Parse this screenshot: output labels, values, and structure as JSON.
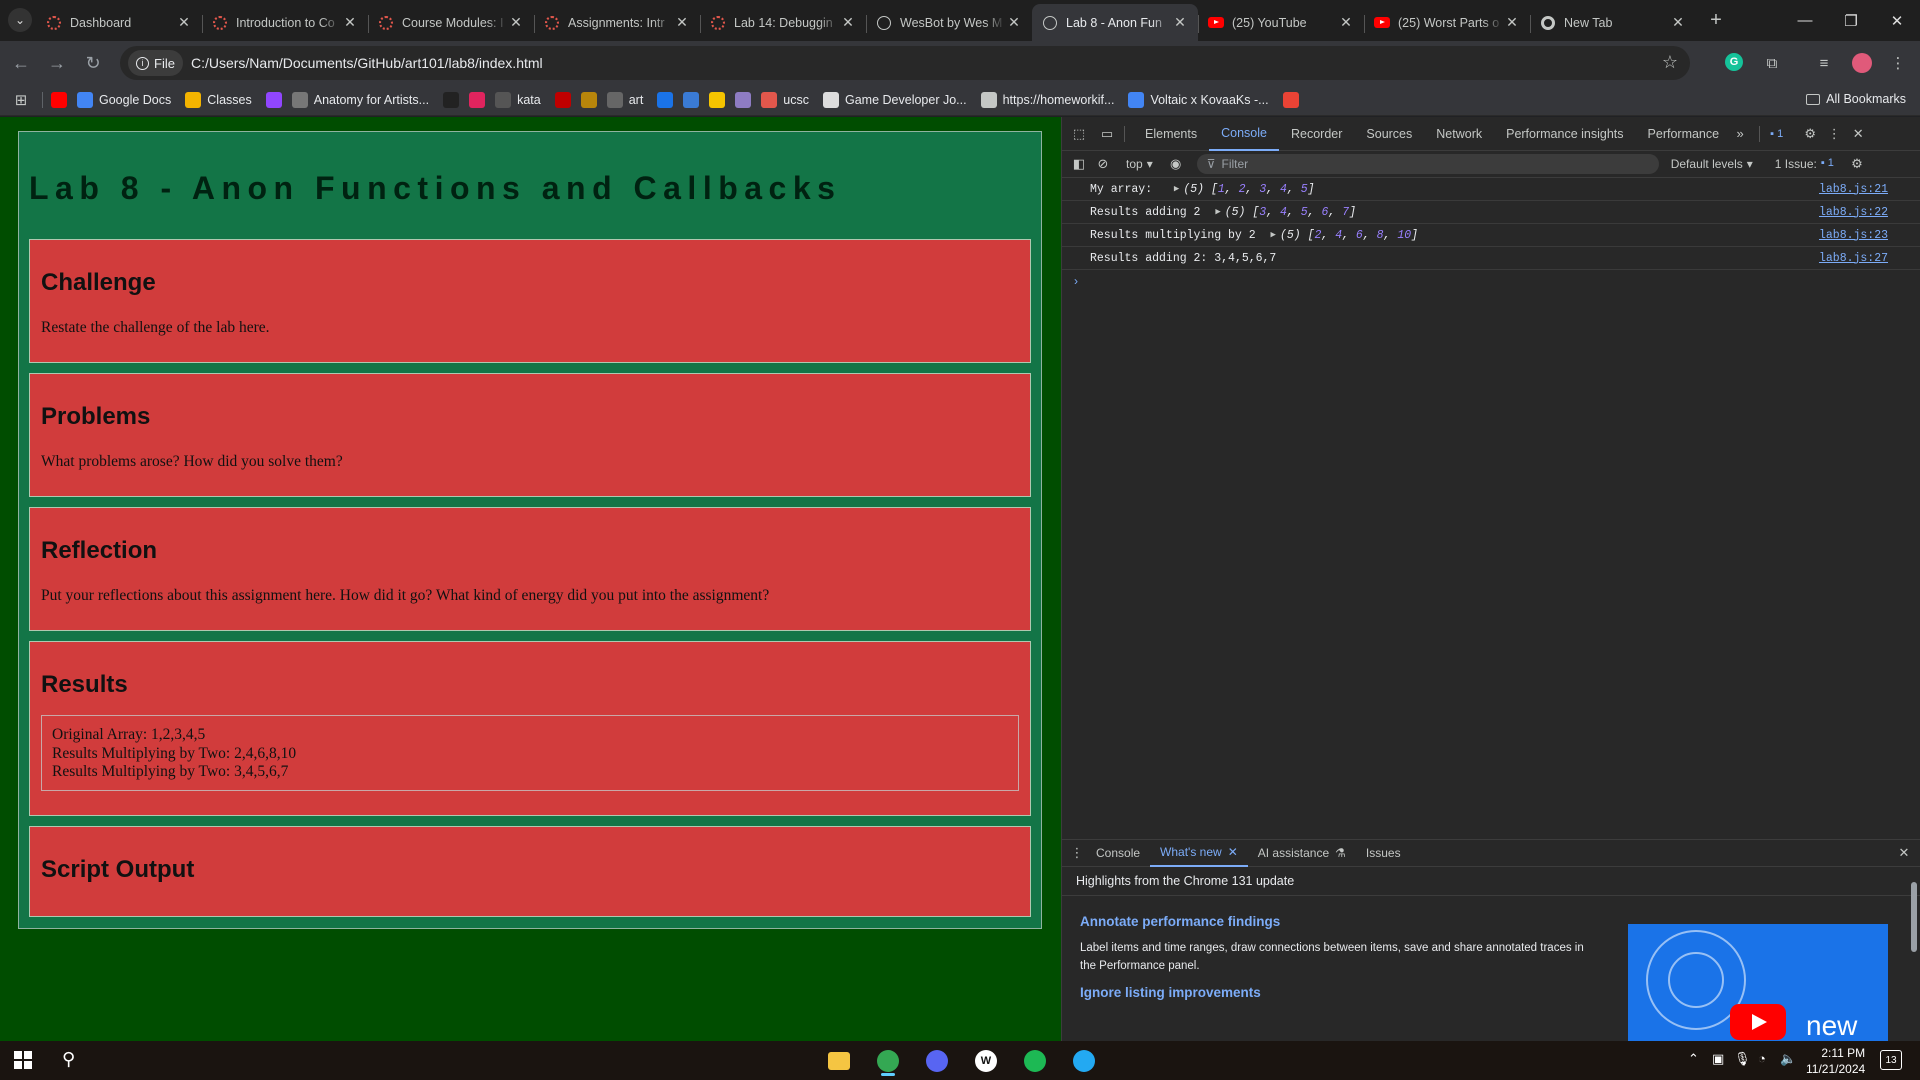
{
  "browser": {
    "tabs": [
      {
        "title": "Dashboard",
        "icon": "canvas-icon"
      },
      {
        "title": "Introduction to Co",
        "icon": "canvas-icon"
      },
      {
        "title": "Course Modules: I",
        "icon": "canvas-icon"
      },
      {
        "title": "Assignments: Intr",
        "icon": "canvas-icon"
      },
      {
        "title": "Lab 14: Debuggin",
        "icon": "canvas-icon"
      },
      {
        "title": "WesBot by Wes M",
        "icon": "web-icon"
      },
      {
        "title": "Lab 8 - Anon Fun",
        "icon": "web-icon",
        "active": true
      },
      {
        "title": "(25) YouTube",
        "icon": "youtube-icon"
      },
      {
        "title": "(25) Worst Parts o",
        "icon": "youtube-icon"
      },
      {
        "title": "New Tab",
        "icon": "chrome-icon"
      }
    ],
    "close_glyph": "✕",
    "new_tab_glyph": "+",
    "window_controls": {
      "minimize": "—",
      "restore": "❐",
      "close": "✕"
    },
    "omnibox": {
      "chip_label": "File",
      "url": "C:/Users/Nam/Documents/GitHub/art101/lab8/index.html"
    },
    "bookmarks": [
      {
        "label": "",
        "icon": "youtube-icon",
        "color": "#ff0000"
      },
      {
        "label": "Google Docs",
        "icon": "docs-icon",
        "color": "#4285f4"
      },
      {
        "label": "Classes",
        "icon": "classes-icon",
        "color": "#f4b400"
      },
      {
        "label": "",
        "icon": "twitch-icon",
        "color": "#9146ff"
      },
      {
        "label": "Anatomy for Artists...",
        "icon": "anatomy-icon",
        "color": "#777777"
      },
      {
        "label": "",
        "icon": "w-icon",
        "color": "#222222"
      },
      {
        "label": "",
        "icon": "red-app-icon",
        "color": "#e0245e"
      },
      {
        "label": "kata",
        "icon": "kata-icon",
        "color": "#555555"
      },
      {
        "label": "",
        "icon": "red-dot-icon",
        "color": "#c00000"
      },
      {
        "label": "",
        "icon": "wand-icon",
        "color": "#b8860b"
      },
      {
        "label": "art",
        "icon": "art-icon",
        "color": "#666666"
      },
      {
        "label": "",
        "icon": "check-icon",
        "color": "#1a73e8"
      },
      {
        "label": "",
        "icon": "bird-icon",
        "color": "#3a7bd5"
      },
      {
        "label": "",
        "icon": "dp-icon",
        "color": "#f5c400"
      },
      {
        "label": "",
        "icon": "image-icon",
        "color": "#8e7cc3"
      },
      {
        "label": "ucsc",
        "icon": "canvas-icon",
        "color": "#e2574c"
      },
      {
        "label": "Game Developer Jo...",
        "icon": "star-icon",
        "color": "#dddddd"
      },
      {
        "label": "https://homeworkif...",
        "icon": "globe-icon",
        "color": "#c4c7c5"
      },
      {
        "label": "Voltaic x KovaaKs -...",
        "icon": "docs-icon",
        "color": "#4285f4"
      },
      {
        "label": "",
        "icon": "gmail-icon",
        "color": "#ea4335"
      }
    ],
    "all_bookmarks": "All Bookmarks"
  },
  "page": {
    "title": "Lab 8 - Anon Functions and Callbacks",
    "sections": [
      {
        "heading": "Challenge",
        "body": "Restate the challenge of the lab here."
      },
      {
        "heading": "Problems",
        "body": "What problems arose? How did you solve them?"
      },
      {
        "heading": "Reflection",
        "body": "Put your reflections about this assignment here. How did it go? What kind of energy did you put into the assignment?"
      },
      {
        "heading": "Results",
        "lines": [
          "Original Array: 1,2,3,4,5",
          "Results Multiplying by Two: 2,4,6,8,10",
          "Results Multiplying by Two: 3,4,5,6,7"
        ]
      },
      {
        "heading": "Script Output"
      }
    ],
    "colors": {
      "background": "#004d00",
      "main": "#137547",
      "section": "#d13c3c"
    }
  },
  "devtools": {
    "tabs": [
      "Elements",
      "Console",
      "Recorder",
      "Sources",
      "Network",
      "Performance insights",
      "Performance"
    ],
    "active_tab": "Console",
    "overflow_glyph": "»",
    "message_badge": "1",
    "context": "top",
    "filter_placeholder": "Filter",
    "levels": "Default levels",
    "issues": "1 Issue:",
    "issues_count": "1",
    "console": [
      {
        "label": "My array:  ",
        "expandable": true,
        "len": "(5)",
        "items": [
          "1",
          "2",
          "3",
          "4",
          "5"
        ],
        "source": "lab8.js:21"
      },
      {
        "label": "Results adding 2 ",
        "expandable": true,
        "len": "(5)",
        "items": [
          "3",
          "4",
          "5",
          "6",
          "7"
        ],
        "source": "lab8.js:22"
      },
      {
        "label": "Results multiplying by 2 ",
        "expandable": true,
        "len": "(5)",
        "items": [
          "2",
          "4",
          "6",
          "8",
          "10"
        ],
        "source": "lab8.js:23"
      },
      {
        "label": "Results adding 2: 3,4,5,6,7",
        "expandable": false,
        "source": "lab8.js:27"
      }
    ],
    "prompt": "›",
    "drawer": {
      "tabs": [
        "Console",
        "What's new",
        "AI assistance",
        "Issues"
      ],
      "active_tab": "What's new",
      "header": "Highlights from the Chrome 131 update",
      "items": [
        {
          "title": "Annotate performance findings",
          "desc": "Label items and time ranges, draw connections between items, save and share annotated traces in the Performance panel."
        },
        {
          "title": "Ignore listing improvements"
        }
      ],
      "thumb_text": "new"
    }
  },
  "taskbar": {
    "apps": [
      {
        "name": "file-explorer-icon",
        "color": "#f5c542"
      },
      {
        "name": "chrome-icon",
        "color": "#34a853",
        "active": true
      },
      {
        "name": "discord-icon",
        "color": "#5865f2"
      },
      {
        "name": "wattpad-icon",
        "color": "#ffffff",
        "text": "W"
      },
      {
        "name": "spotify-icon",
        "color": "#1db954"
      },
      {
        "name": "vscode-icon",
        "color": "#23a9f2"
      }
    ],
    "time": "2:11 PM",
    "date": "11/21/2024",
    "notifications": "13"
  }
}
